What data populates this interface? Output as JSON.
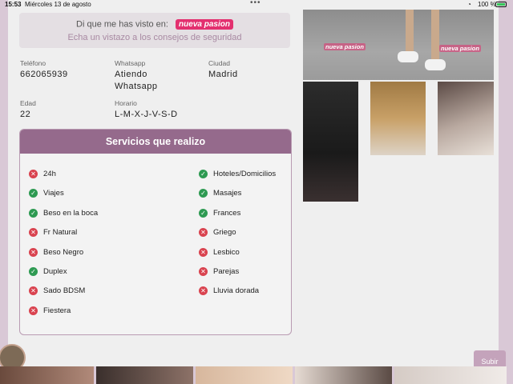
{
  "statusbar": {
    "time": "15:53",
    "date": "Miércoles 13 de agosto",
    "battery": "100 %"
  },
  "seen": {
    "prefix": "Di que me has visto en:",
    "logo_text": "nueva pasion",
    "safety_link": "Echa un vistazo a los consejos de seguridad"
  },
  "info": {
    "phone_label": "Teléfono",
    "phone_value": "662065939",
    "whatsapp_label": "Whatsapp",
    "whatsapp_value_1": "Atiendo",
    "whatsapp_value_2": "Whatsapp",
    "city_label": "Ciudad",
    "city_value": "Madrid",
    "age_label": "Edad",
    "age_value": "22",
    "schedule_label": "Horario",
    "schedule_value": "L-M-X-J-V-S-D"
  },
  "services": {
    "title": "Servicios que realizo",
    "left": [
      {
        "label": "24h",
        "status": "no"
      },
      {
        "label": "Viajes",
        "status": "yes"
      },
      {
        "label": "Beso en la boca",
        "status": "yes"
      },
      {
        "label": "Fr Natural",
        "status": "no"
      },
      {
        "label": "Beso Negro",
        "status": "no"
      },
      {
        "label": "Duplex",
        "status": "yes"
      },
      {
        "label": "Sado BDSM",
        "status": "no"
      },
      {
        "label": "Fiestera",
        "status": "no"
      }
    ],
    "right": [
      {
        "label": "Hoteles/Domicilios",
        "status": "yes"
      },
      {
        "label": "Masajes",
        "status": "yes"
      },
      {
        "label": "Frances",
        "status": "yes"
      },
      {
        "label": "Griego",
        "status": "no"
      },
      {
        "label": "Lesbico",
        "status": "no"
      },
      {
        "label": "Parejas",
        "status": "no"
      },
      {
        "label": "Lluvia dorada",
        "status": "no"
      }
    ]
  },
  "photos": {
    "watermark": "nueva pasion"
  },
  "actions": {
    "subir_label": "Subir"
  },
  "colors": {
    "accent": "#956a8c",
    "yes": "#2e9a52",
    "no": "#d9434f"
  }
}
